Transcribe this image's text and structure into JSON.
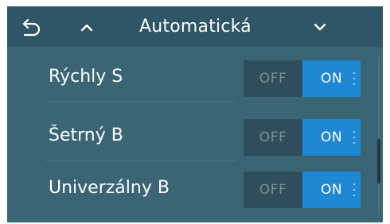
{
  "header": {
    "title": "Automatická",
    "back_icon": "back-arrow-icon",
    "up_icon": "chevron-up-icon",
    "down_icon": "chevron-down-icon"
  },
  "programs": [
    {
      "label": "Rýchly S",
      "off_label": "OFF",
      "on_label": "ON",
      "state": "ON"
    },
    {
      "label": "Šetrný B",
      "off_label": "OFF",
      "on_label": "ON",
      "state": "ON"
    },
    {
      "label": "Univerzálny B",
      "off_label": "OFF",
      "on_label": "ON",
      "state": "ON"
    }
  ],
  "colors": {
    "background": "#3a6574",
    "header": "#2e5666",
    "toggle_on": "#1f88d4",
    "toggle_off": "#2f4d5a"
  }
}
